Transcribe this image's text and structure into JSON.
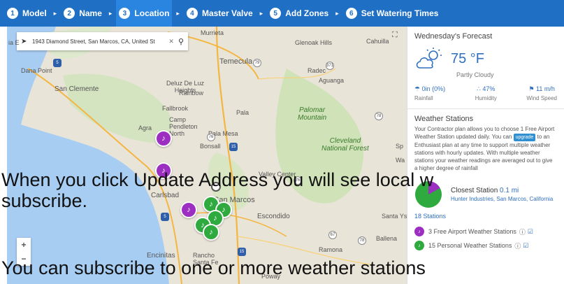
{
  "steps": [
    {
      "num": "1",
      "label": "Model"
    },
    {
      "num": "2",
      "label": "Name"
    },
    {
      "num": "3",
      "label": "Location"
    },
    {
      "num": "4",
      "label": "Master Valve"
    },
    {
      "num": "5",
      "label": "Add Zones"
    },
    {
      "num": "6",
      "label": "Set Watering Times"
    }
  ],
  "step_separator": "▸",
  "map": {
    "address": "1943 Diamond Street, San Marcos, CA, United St",
    "labels": {
      "murrieta": "Murrieta",
      "glenoak": "Glenoak Hills",
      "cahuilla": "Cahuilla",
      "temecula": "Temecula",
      "radec": "Radec",
      "aguanga": "Aguanga",
      "dana_point": "Dana Point",
      "san_clemente": "San Clemente",
      "deluz": "Deluz De Luz\nHeights",
      "rainbow": "Rainbow",
      "fallbrook": "Fallbrook",
      "pala": "Pala",
      "palomar": "Palomar\nMountain",
      "agra": "Agra",
      "camp": "Camp\nPendleton\nNorth",
      "bonsall": "Bonsall",
      "pala_mesa": "Pala Mesa",
      "cleveland": "Cleveland\nNational Forest",
      "valley_center": "Valley Center",
      "carlsbad": "Carlsbad",
      "san_marcos": "San Marcos",
      "escondido": "Escondido",
      "santa_ysabel": "Santa Ys",
      "ballena": "Ballena",
      "ramona": "Ramona",
      "encinitas": "Encinitas",
      "rancho": "Rancho\nSanta Fe",
      "poway": "Poway",
      "la_edge": "ia E",
      "sp": "Sp",
      "wa": "Wa"
    },
    "shields": [
      "5",
      "79",
      "371",
      "76",
      "15",
      "78",
      "5",
      "76",
      "78",
      "67",
      "15"
    ],
    "zoom_in": "+",
    "zoom_out": "−",
    "fullscreen": "⛶"
  },
  "forecast": {
    "title": "Wednesday's Forecast",
    "temp": "75 °F",
    "condition": "Partly Cloudy",
    "rainfall_value": "0in (0%)",
    "rainfall_label": "Rainfall",
    "humidity_value": "47%",
    "humidity_label": "Humidity",
    "wind_value": "11 m/h",
    "wind_label": "Wind Speed"
  },
  "weather_stations": {
    "title": "Weather Stations",
    "desc_1": "Your Contractor plan allows you to choose 1 Free Airport Weather Station updated daily. You can",
    "upgrade_badge": "upgrade",
    "desc_2": "to an Enthusiast plan at any time to support multiple weather stations with hourly updates. With multiple weather stations your weather readings are",
    "desc_3": "averaged out to give a higher degree of rainfall",
    "closest_label": "Closest Station",
    "closest_dist": "0.1 mi",
    "closest_location": "Hunter Industries, San Marcos, California",
    "stations_count": "18 Stations",
    "airport_stations": "3 Free Airport Weather Stations",
    "personal_stations": "15 Personal Weather Stations",
    "info_icon": "ⓘ",
    "check_icon": "☑"
  },
  "pie": {
    "purple_pct": 17,
    "green_pct": 83
  },
  "colors": {
    "step_bar": "#1f6fc5",
    "airport": "#9c2fc2",
    "personal": "#2eaa3f",
    "link": "#2f6fbf"
  },
  "captions": {
    "line1": "When you click Update Address you will see local w",
    "line2": "subscribe.",
    "line3": "You can subscribe to one or more weather stations"
  }
}
